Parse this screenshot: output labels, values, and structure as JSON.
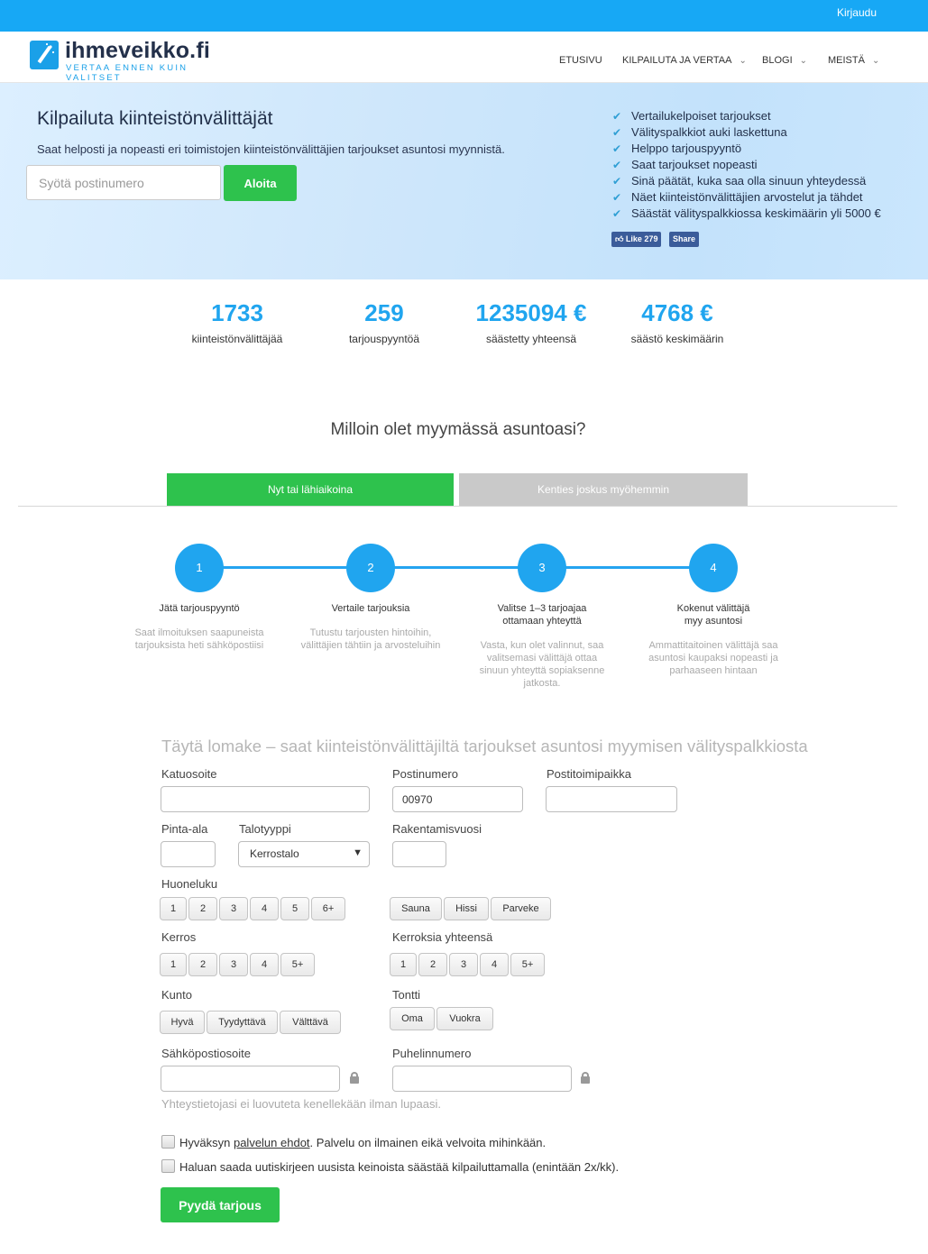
{
  "topbar": {
    "login": "Kirjaudu"
  },
  "header": {
    "logo_name": "ihmeveikko.fi",
    "logo_tagline": "VERTAA ENNEN KUIN VALITSET",
    "nav": [
      "ETUSIVU",
      "KILPAILUTA JA VERTAA",
      "BLOGI",
      "MEISTÄ"
    ]
  },
  "hero": {
    "title": "Kilpailuta kiinteistönvälittäjät",
    "subtitle": "Saat helposti ja nopeasti eri toimistojen kiinteistönvälittäjien tarjoukset asuntosi myynnistä.",
    "postcode_placeholder": "Syötä postinumero",
    "start_button": "Aloita",
    "features": [
      "Vertailukelpoiset tarjoukset",
      "Välityspalkkiot auki laskettuna",
      "Helppo tarjouspyyntö",
      "Saat tarjoukset nopeasti",
      "Sinä päätät, kuka saa olla sinuun yhteydessä",
      "Näet kiinteistönvälittäjien arvostelut ja tähdet",
      "Säästät välityspalkkiossa keskimäärin yli 5000 €"
    ],
    "fb_like": "Like 279",
    "fb_share": "Share"
  },
  "stats": [
    {
      "value": "1733",
      "label": "kiinteistönvälittäjää"
    },
    {
      "value": "259",
      "label": "tarjouspyyntöä"
    },
    {
      "value": "1235094 €",
      "label": "säästetty yhteensä"
    },
    {
      "value": "4768 €",
      "label": "säästö keskimäärin"
    }
  ],
  "question": "Milloin olet myymässä asuntoasi?",
  "tabs": {
    "active": "Nyt tai lähiaikoina",
    "inactive": "Kenties joskus myöhemmin"
  },
  "steps": [
    {
      "num": "1",
      "title": "Jätä tarjouspyyntö",
      "title2": "",
      "desc": "Saat ilmoituksen saapuneista tarjouksista heti sähköpostiisi"
    },
    {
      "num": "2",
      "title": "Vertaile tarjouksia",
      "title2": "",
      "desc": "Tutustu tarjousten hintoihin, välittäjien tähtiin ja arvosteluihin"
    },
    {
      "num": "3",
      "title": "Valitse 1–3 tarjoajaa",
      "title2": "ottamaan yhteyttä",
      "desc": "Vasta, kun olet valinnut, saa valitsemasi välittäjä ottaa sinuun yhteyttä sopiaksenne jatkosta."
    },
    {
      "num": "4",
      "title": "Kokenut välittäjä",
      "title2": "myy asuntosi",
      "desc": "Ammattitaitoinen välittäjä saa asuntosi kaupaksi nopeasti ja parhaaseen hintaan"
    }
  ],
  "form": {
    "title": "Täytä lomake – saat kiinteistönvälittäjiltä tarjoukset asuntosi myymisen välityspalkkiosta",
    "labels": {
      "street": "Katuosoite",
      "postcode": "Postinumero",
      "city": "Postitoimipaikka",
      "area": "Pinta-ala",
      "house_type": "Talotyyppi",
      "year": "Rakentamisvuosi",
      "rooms": "Huoneluku",
      "floor": "Kerros",
      "floors_total": "Kerroksia yhteensä",
      "condition": "Kunto",
      "plot": "Tontti",
      "email": "Sähköpostiosoite",
      "phone": "Puhelinnumero"
    },
    "postcode_value": "00970",
    "house_type_value": "Kerrostalo",
    "rooms": [
      "1",
      "2",
      "3",
      "4",
      "5",
      "6+"
    ],
    "extras": [
      "Sauna",
      "Hissi",
      "Parveke"
    ],
    "floor": [
      "1",
      "2",
      "3",
      "4",
      "5+"
    ],
    "floors_total": [
      "1",
      "2",
      "3",
      "4",
      "5+"
    ],
    "condition": [
      "Hyvä",
      "Tyydyttävä",
      "Välttävä"
    ],
    "plot": [
      "Oma",
      "Vuokra"
    ],
    "privacy_note": "Yhteystietojasi ei luovuteta kenellekään ilman lupaasi.",
    "terms_pre": "Hyväksyn ",
    "terms_link": "palvelun ehdot",
    "terms_post": ". Palvelu on ilmainen eikä velvoita mihinkään.",
    "newsletter": "Haluan saada uutiskirjeen uusista keinoista säästää kilpailuttamalla (enintään 2x/kk).",
    "submit": "Pyydä tarjous"
  }
}
